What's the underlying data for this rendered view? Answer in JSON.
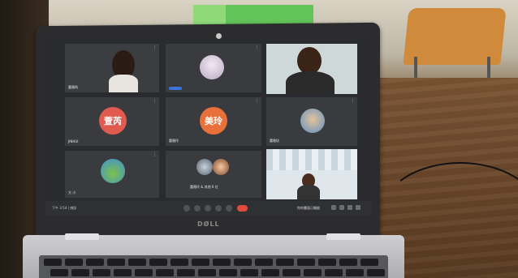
{
  "laptop": {
    "brand_logo": "DØLL"
  },
  "meeting": {
    "tiles": [
      {
        "id": "t1",
        "label": "蕾雅昀",
        "kind": "video"
      },
      {
        "id": "t2",
        "label": "",
        "kind": "avatar"
      },
      {
        "id": "t3",
        "label": "",
        "kind": "video"
      },
      {
        "id": "t4",
        "label": "JINHUI",
        "kind": "name",
        "name_text": "萱芮",
        "color": "#e05a4f"
      },
      {
        "id": "t5",
        "label": "蕾雅玲",
        "kind": "name",
        "name_text": "美玲",
        "color": "#e8703a"
      },
      {
        "id": "t6",
        "label": "蕾雅玫",
        "kind": "avatar"
      },
      {
        "id": "t7",
        "label": "大 小",
        "kind": "avatar"
      },
      {
        "id": "t8",
        "label": "蕾雅玲 & 其他 6 位",
        "kind": "group"
      },
      {
        "id": "t9",
        "label": "",
        "kind": "presentation"
      }
    ],
    "control_bar": {
      "time": "下午 3:54 | 視訊",
      "status_text": "你的畫面已開啟"
    }
  }
}
